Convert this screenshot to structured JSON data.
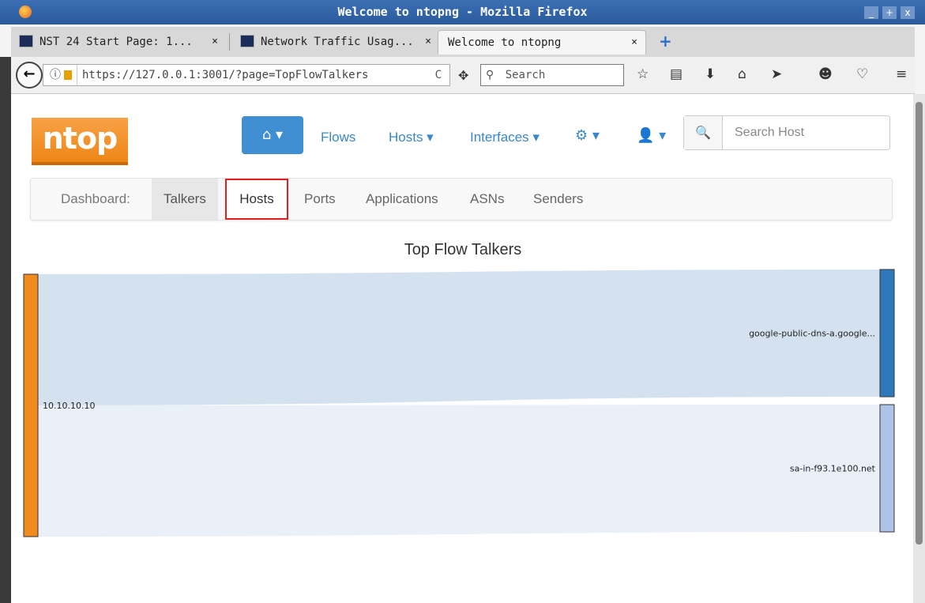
{
  "window": {
    "title": "Welcome to ntopng - Mozilla Firefox",
    "min": "_",
    "max": "+",
    "close": "x"
  },
  "tabs": [
    {
      "label": "NST 24 Start Page: 1...",
      "close": "×"
    },
    {
      "label": "Network Traffic Usag...",
      "close": "×"
    },
    {
      "label": "Welcome to ntopng",
      "close": "×"
    }
  ],
  "newtab": "+",
  "navbar": {
    "url": "https://127.0.0.1:3001/?page=TopFlowTalkers",
    "search_placeholder": "Search",
    "back": "←",
    "reload": "C",
    "info": "ⓘ"
  },
  "ntop": {
    "logo": "ntop",
    "home_label": "⌂ ▾",
    "nav": {
      "flows": "Flows",
      "hosts": "Hosts ▾",
      "interfaces": "Interfaces ▾",
      "settings": "⚙ ▾",
      "user": "👤 ▾"
    },
    "search_placeholder": "Search Host",
    "search_icon": "🔍"
  },
  "dashboard": {
    "label": "Dashboard:",
    "items": [
      "Talkers",
      "Hosts",
      "Ports",
      "Applications",
      "ASNs",
      "Senders"
    ]
  },
  "chart_data": {
    "type": "sankey",
    "title": "Top Flow Talkers",
    "sources": [
      {
        "name": "10.10.10.10",
        "color": "#f28b1d"
      }
    ],
    "targets": [
      {
        "name": "google-public-dns-a.google...",
        "color": "#2f78b9"
      },
      {
        "name": "sa-in-f93.1e100.net",
        "color": "#adc4e8"
      }
    ],
    "links": [
      {
        "source": "10.10.10.10",
        "target": "google-public-dns-a.google...",
        "value": 50,
        "color": "#d3e2ee"
      },
      {
        "source": "10.10.10.10",
        "target": "sa-in-f93.1e100.net",
        "value": 50,
        "color": "#eaf0f7"
      }
    ]
  }
}
